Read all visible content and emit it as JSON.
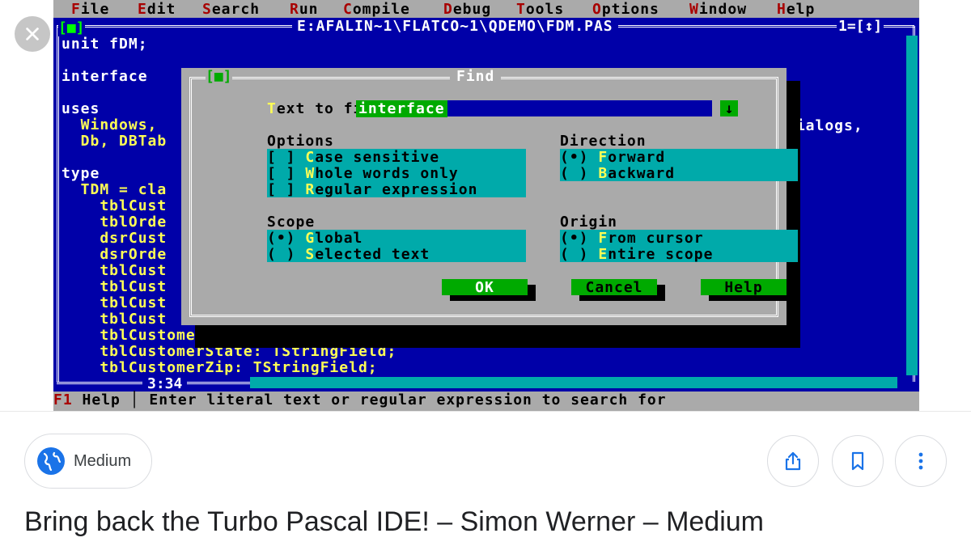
{
  "menu": [
    {
      "label": "File",
      "hot": "F",
      "rest": "ile"
    },
    {
      "label": "Edit",
      "hot": "E",
      "rest": "dit"
    },
    {
      "label": "Search",
      "hot": "S",
      "rest": "earch"
    },
    {
      "label": "Run",
      "hot": "R",
      "rest": "un"
    },
    {
      "label": "Compile",
      "hot": "C",
      "rest": "ompile"
    },
    {
      "label": "Debug",
      "hot": "D",
      "rest": "ebug"
    },
    {
      "label": "Tools",
      "hot": "T",
      "rest": "ools"
    },
    {
      "label": "Options",
      "hot": "O",
      "rest": "ptions"
    },
    {
      "label": "Window",
      "hot": "W",
      "rest": "indow"
    },
    {
      "label": "Help",
      "hot": "H",
      "rest": "elp"
    }
  ],
  "editor": {
    "file_path": "E:AFALIN~1\\FLATCO~1\\QDEMO\\FDM.PAS",
    "window_number": "1=[↕]",
    "close_box": "[■]",
    "cursor_pos": "3:34",
    "right_fragment": "Dialogs,",
    "lines": [
      {
        "text": "unit fDM;",
        "color": "white"
      },
      {
        "text": "",
        "color": "white"
      },
      {
        "text": "interface",
        "color": "white"
      },
      {
        "text": "",
        "color": "white"
      },
      {
        "text": "uses",
        "color": "white"
      },
      {
        "text": "  Windows,",
        "color": "yellow"
      },
      {
        "text": "  Db, DBTab",
        "color": "yellow"
      },
      {
        "text": "",
        "color": "white"
      },
      {
        "text": "type",
        "color": "white"
      },
      {
        "text": "  TDM = cla",
        "color": "yellow"
      },
      {
        "text": "    tblCust",
        "color": "yellow"
      },
      {
        "text": "    tblOrde",
        "color": "yellow"
      },
      {
        "text": "    dsrCust",
        "color": "yellow"
      },
      {
        "text": "    dsrOrde",
        "color": "yellow"
      },
      {
        "text": "    tblCust",
        "color": "yellow"
      },
      {
        "text": "    tblCust",
        "color": "yellow"
      },
      {
        "text": "    tblCust",
        "color": "yellow"
      },
      {
        "text": "    tblCust",
        "color": "yellow"
      },
      {
        "text": "    tblCustomerCity: TStringField;",
        "color": "yellow"
      },
      {
        "text": "    tblCustomerState: TStringField;",
        "color": "yellow"
      },
      {
        "text": "    tblCustomerZip: TStringField;",
        "color": "yellow"
      }
    ]
  },
  "status": {
    "key": "F1",
    "key_label": " Help ",
    "sep": "│",
    "message": " Enter literal text or regular expression to search for"
  },
  "find_dialog": {
    "title": "Find",
    "close_box": "[■]",
    "text_label_hot": "T",
    "text_label_rest": "ext to find",
    "text_value": "interface",
    "dropdown_glyph": "↓",
    "options_label": "Options",
    "options": [
      {
        "mark": "[ ] ",
        "hot": "C",
        "rest": "ase sensitive"
      },
      {
        "mark": "[ ] ",
        "hot": "W",
        "rest": "hole words only"
      },
      {
        "mark": "[ ] ",
        "hot": "R",
        "rest": "egular expression"
      }
    ],
    "direction_label": "Direction",
    "direction": [
      {
        "mark": "(•) ",
        "hot": "F",
        "rest": "orward"
      },
      {
        "mark": "( ) ",
        "hot": "B",
        "rest": "ackward"
      }
    ],
    "scope_label": "Scope",
    "scope": [
      {
        "mark": "(•) ",
        "hot": "G",
        "rest": "lobal"
      },
      {
        "mark": "( ) ",
        "hot": "S",
        "rest": "elected text"
      }
    ],
    "origin_label": "Origin",
    "origin": [
      {
        "mark": "(•) ",
        "hot": "F",
        "rest": "rom cursor"
      },
      {
        "mark": "( ) ",
        "hot": "E",
        "rest": "ntire scope"
      }
    ],
    "ok_label": "OK",
    "cancel_label": "Cancel",
    "help_label": "Help"
  },
  "source": {
    "name": "Medium"
  },
  "caption": "Bring back the Turbo Pascal IDE! – Simon Werner – Medium",
  "colors": {
    "dos_blue": "#0000a8",
    "dos_gray": "#aaaaaa",
    "dos_cyan": "#00aaaa",
    "dos_green": "#00aa00",
    "dos_yellow": "#ffff55",
    "medium_blue": "#1a73e8"
  },
  "icons": [
    "close-icon",
    "globe-icon",
    "share-icon",
    "bookmark-icon",
    "more-vert-icon"
  ]
}
